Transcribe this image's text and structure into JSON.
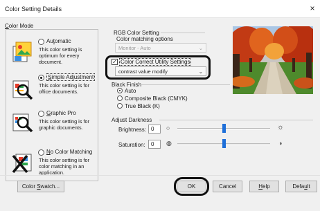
{
  "window": {
    "title": "Color Setting Details",
    "close_glyph": "×"
  },
  "color_mode": {
    "label_prefix": "C",
    "label_rest": "olor Mode",
    "modes": [
      {
        "name_before": "Au",
        "name_mnemonic": "t",
        "name_after": "omatic",
        "description": "This color setting is optimum for every document.",
        "selected": false,
        "icon": "photo-doc-icon"
      },
      {
        "name_before": "",
        "name_mnemonic": "S",
        "name_after": "imple Adjustment",
        "description": "This color setting is for office documents.",
        "selected": true,
        "icon": "magnifier-chart-icon"
      },
      {
        "name_before": "",
        "name_mnemonic": "G",
        "name_after": "raphic Pro",
        "description": "This color setting is for graphic documents.",
        "selected": false,
        "icon": "magnifier-graphic-icon"
      },
      {
        "name_before": "",
        "name_mnemonic": "N",
        "name_after": "o Color Matching",
        "description": "This color setting is for color matching in an application.",
        "selected": false,
        "icon": "no-color-matching-icon"
      }
    ]
  },
  "rgb_setting": {
    "title": "RGB Color Setting",
    "subtitle": "Color matching options",
    "matching_value": "Monitor - Auto",
    "color_correct_label": "Color Correct Utility Settings",
    "color_correct_checked": true,
    "color_correct_value": "contrast value modify",
    "dropdown_glyph": "⌄"
  },
  "black_finish": {
    "title": "Black Finish",
    "options": [
      {
        "label": "Auto",
        "selected": true
      },
      {
        "label": "Composite Black (CMYK)",
        "selected": false
      },
      {
        "label": "True Black (K)",
        "selected": false
      }
    ]
  },
  "adjust_darkness": {
    "title": "Adjust Darkness",
    "brightness_label": "Brightness:",
    "brightness_value": "0",
    "saturation_label": "Saturation:",
    "saturation_value": "0",
    "brightness_level": 0.5,
    "saturation_level": 0.5
  },
  "buttons": {
    "swatch_before": "Color ",
    "swatch_mnemonic": "S",
    "swatch_after": "watch...",
    "ok": "OK",
    "cancel": "Cancel",
    "help_mnemonic": "H",
    "help_rest": "elp",
    "default_before": "Defa",
    "default_mnemonic": "u",
    "default_after": "lt"
  },
  "colors": {
    "slider_thumb": "#1e6fd9",
    "dialog_bg": "#f0f0f0"
  }
}
